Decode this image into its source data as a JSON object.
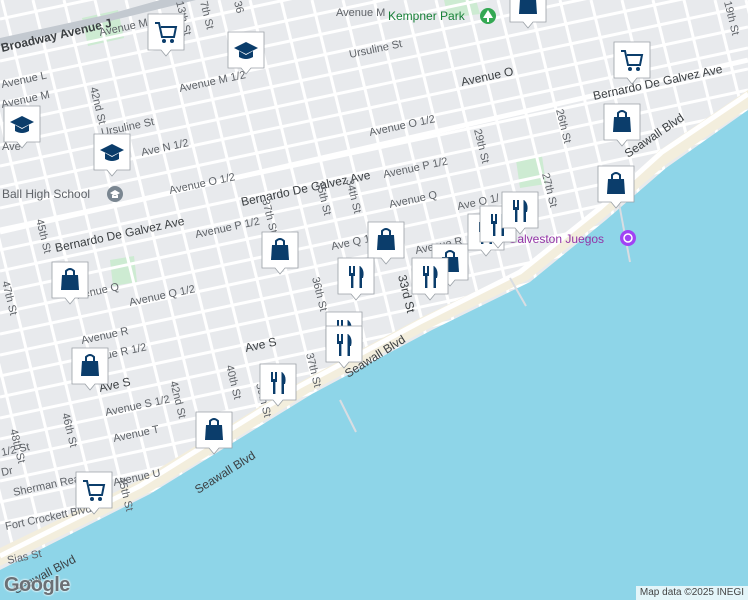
{
  "map": {
    "colors": {
      "land": "#e8eaed",
      "road": "#ffffff",
      "highway": "#c3c9d0",
      "water": "#8ed5e8",
      "beach": "#f3eedd",
      "park": "#cdebd2",
      "pin_icon": "#0b3d6b"
    },
    "street_labels": [
      {
        "id": "broadway",
        "text": "Broadway Avenue J"
      },
      {
        "id": "avenue-m",
        "text": "Avenue M"
      },
      {
        "id": "avenue-m-half-a",
        "text": "Avenue M 1/"
      },
      {
        "id": "avenue-m-half-b",
        "text": "Avenue M 1/2"
      },
      {
        "id": "avenue-l",
        "text": "Avenue L"
      },
      {
        "id": "avenue-m-left",
        "text": "Avenue M"
      },
      {
        "id": "ursuline",
        "text": "Ursuline St"
      },
      {
        "id": "ursuline-left",
        "text": "Ursuline St"
      },
      {
        "id": "avenue-o",
        "text": "Avenue O"
      },
      {
        "id": "avenue-o-half",
        "text": "Avenue O 1/2"
      },
      {
        "id": "avenue-o-half-left",
        "text": "Avenue O 1/2"
      },
      {
        "id": "ave-n-half",
        "text": "Ave N 1/2"
      },
      {
        "id": "bdg-ave-mid",
        "text": "Bernardo De Galvez Ave"
      },
      {
        "id": "bdg-ave-left",
        "text": "Bernardo De Galvez Ave"
      },
      {
        "id": "bdg-ave-right",
        "text": "Bernardo De Galvez Ave"
      },
      {
        "id": "avenue-p-half",
        "text": "Avenue P 1/2"
      },
      {
        "id": "avenue-p-half-left",
        "text": "Avenue P 1/2"
      },
      {
        "id": "avenue-q",
        "text": "Avenue Q"
      },
      {
        "id": "avenue-q-left",
        "text": "Avenue Q"
      },
      {
        "id": "ave-q-half",
        "text": "Ave Q 1"
      },
      {
        "id": "avenue-q-half-left",
        "text": "Avenue Q 1/2"
      },
      {
        "id": "avenue-r",
        "text": "Avenue R"
      },
      {
        "id": "avenue-r-left",
        "text": "Avenue R"
      },
      {
        "id": "avenue-r-half",
        "text": "Avenue R 1/2"
      },
      {
        "id": "ave-s",
        "text": "Ave S"
      },
      {
        "id": "ave-s-left",
        "text": "Ave S"
      },
      {
        "id": "avenue-s-half",
        "text": "Avenue S 1/2"
      },
      {
        "id": "avenue-t",
        "text": "Avenue T"
      },
      {
        "id": "avenue-u",
        "text": "Avenue U"
      },
      {
        "id": "ave-o-half-east",
        "text": "Ave O 1/"
      },
      {
        "id": "seawall-1",
        "text": "Seawall Blvd"
      },
      {
        "id": "seawall-2",
        "text": "Seawall Blvd"
      },
      {
        "id": "seawall-3",
        "text": "Seawall Blvd"
      },
      {
        "id": "seawall-4",
        "text": "Seawall Blvd"
      },
      {
        "id": "fort-crockett",
        "text": "Fort Crockett Blvd"
      },
      {
        "id": "sherman",
        "text": "Sherman Rea"
      },
      {
        "id": "sias",
        "text": "Sias St"
      },
      {
        "id": "dr",
        "text": "Dr"
      },
      {
        "id": "19th",
        "text": "19th St"
      },
      {
        "id": "26th",
        "text": "26th St"
      },
      {
        "id": "27th",
        "text": "27th St"
      },
      {
        "id": "29th",
        "text": "29th St"
      },
      {
        "id": "33rd",
        "text": "33rd St"
      },
      {
        "id": "34th",
        "text": "34th St"
      },
      {
        "id": "35th",
        "text": "35th St"
      },
      {
        "id": "36th",
        "text": "36th St"
      },
      {
        "id": "37th",
        "text": "37th St"
      },
      {
        "id": "37th-b",
        "text": "37th St"
      },
      {
        "id": "39th",
        "text": "39th St"
      },
      {
        "id": "40th",
        "text": "40th St"
      },
      {
        "id": "42nd",
        "text": "42nd St"
      },
      {
        "id": "42nd-b",
        "text": "42nd St"
      },
      {
        "id": "45th",
        "text": "45th St"
      },
      {
        "id": "45th-b",
        "text": "45th St"
      },
      {
        "id": "46th",
        "text": "46th St"
      },
      {
        "id": "47th",
        "text": "47th St"
      },
      {
        "id": "48th",
        "text": "48th St"
      },
      {
        "id": "13th",
        "text": "13th St"
      },
      {
        "id": "7th",
        "text": "7th St"
      },
      {
        "id": "36th-top",
        "text": "36"
      },
      {
        "id": "half-left",
        "text": "1/2 St"
      },
      {
        "id": "ave-label-misc",
        "text": "Ave"
      }
    ],
    "places": [
      {
        "id": "kempner-park",
        "text": "Kempner Park",
        "icon": "tree-icon"
      },
      {
        "id": "ball-high",
        "text": "Ball High School",
        "icon": "school-icon"
      },
      {
        "id": "galveston-juegos",
        "text": "Galveston Juegos",
        "icon": "amusement-icon"
      }
    ],
    "pins": [
      {
        "id": "grocery-1",
        "type": "grocery"
      },
      {
        "id": "school-1",
        "type": "school"
      },
      {
        "id": "bag-top-right",
        "type": "shopping"
      },
      {
        "id": "grocery-2",
        "type": "grocery"
      },
      {
        "id": "school-2",
        "type": "school"
      },
      {
        "id": "school-3",
        "type": "school"
      },
      {
        "id": "bag-26th",
        "type": "shopping"
      },
      {
        "id": "bag-seawall-east",
        "type": "shopping"
      },
      {
        "id": "bag-36th",
        "type": "shopping"
      },
      {
        "id": "bag-33rd-a",
        "type": "shopping"
      },
      {
        "id": "bag-q",
        "type": "shopping"
      },
      {
        "id": "bag-45th",
        "type": "shopping"
      },
      {
        "id": "bag-r",
        "type": "shopping"
      },
      {
        "id": "bag-39th",
        "type": "shopping"
      },
      {
        "id": "restaurant-35th",
        "type": "restaurant"
      },
      {
        "id": "restaurant-36th-a",
        "type": "restaurant"
      },
      {
        "id": "restaurant-36th-b",
        "type": "restaurant"
      },
      {
        "id": "restaurant-39th",
        "type": "restaurant"
      },
      {
        "id": "restaurant-33rd",
        "type": "restaurant"
      },
      {
        "id": "restaurant-30th",
        "type": "restaurant"
      },
      {
        "id": "restaurant-28th-a",
        "type": "restaurant"
      },
      {
        "id": "restaurant-28th-b",
        "type": "restaurant"
      },
      {
        "id": "grocery-3",
        "type": "grocery"
      }
    ],
    "attribution": "Map data ©2025 INEGI",
    "logo": "Google"
  }
}
